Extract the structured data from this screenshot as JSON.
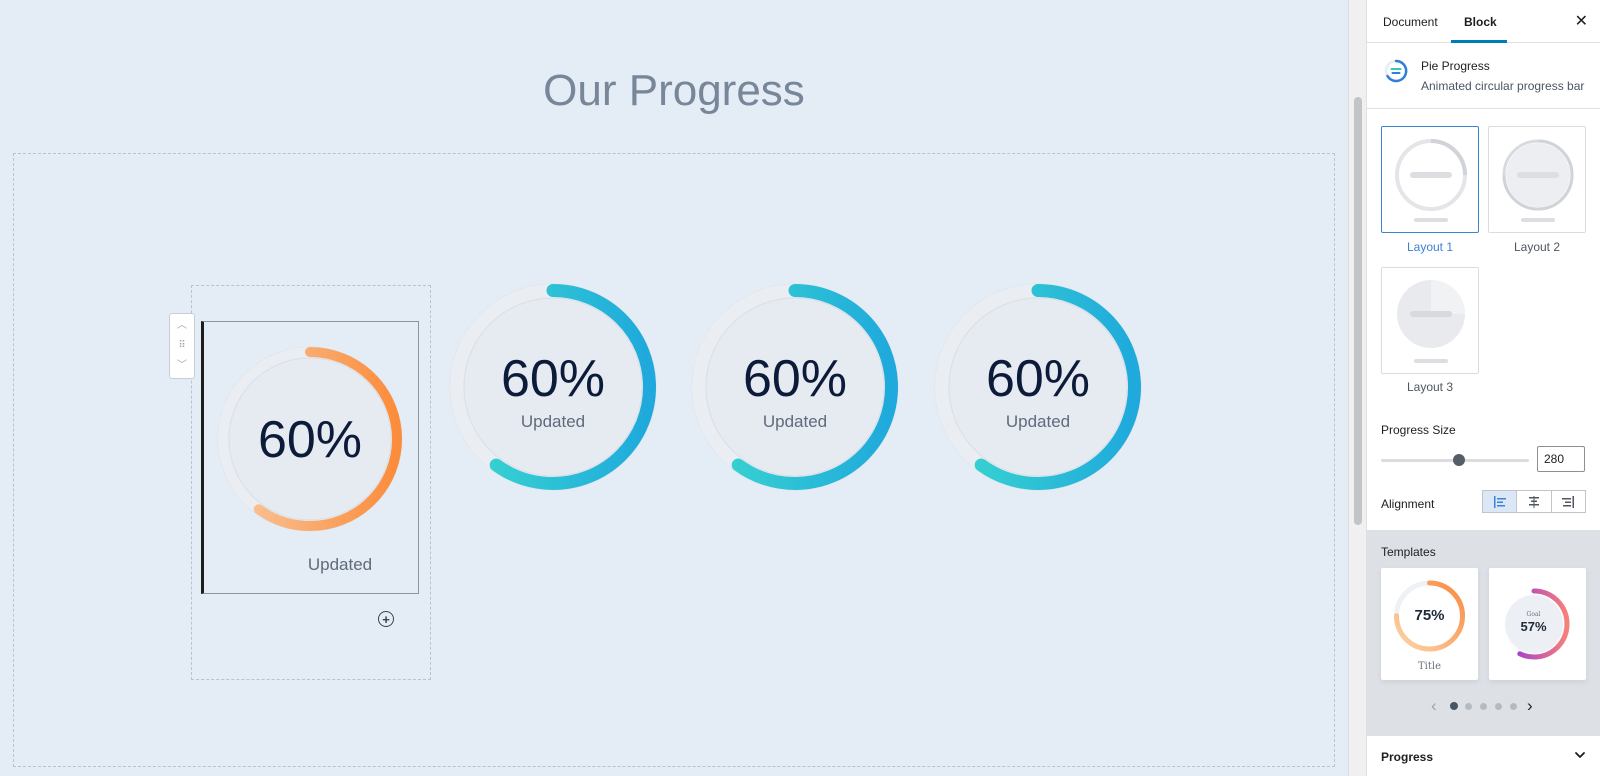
{
  "canvas": {
    "heading": "Our Progress",
    "pies": [
      {
        "percent": "60%",
        "label": "Updated",
        "progress": 0.6,
        "style": "orange"
      },
      {
        "percent": "60%",
        "label": "Updated",
        "progress": 0.6,
        "style": "teal"
      },
      {
        "percent": "60%",
        "label": "Updated",
        "progress": 0.6,
        "style": "teal"
      },
      {
        "percent": "60%",
        "label": "Updated",
        "progress": 0.6,
        "style": "teal"
      }
    ],
    "colors": {
      "orange_start": "#f9c9a1",
      "orange_end": "#fb8c3b",
      "teal_start": "#3ad8cf",
      "teal_end": "#1fa9dc",
      "track": "#eaedf2"
    }
  },
  "sidebar": {
    "tabs": {
      "document": "Document",
      "block": "Block"
    },
    "close_icon": "close-icon",
    "block": {
      "name": "Pie Progress",
      "description": "Animated circular progress bar"
    },
    "layouts": [
      {
        "label": "Layout 1",
        "selected": true
      },
      {
        "label": "Layout 2",
        "selected": false
      },
      {
        "label": "Layout 3",
        "selected": false
      }
    ],
    "progress_size": {
      "label": "Progress Size",
      "value": "280",
      "slider_fraction": 0.53
    },
    "alignment": {
      "label": "Alignment",
      "options": [
        "left",
        "center",
        "right"
      ],
      "selected": "left"
    },
    "templates": {
      "title": "Templates",
      "items": [
        {
          "percent": "75%",
          "caption": "Title",
          "progress": 0.75
        },
        {
          "percent": "57%",
          "caption": "Goal",
          "progress": 0.57
        }
      ],
      "page_count": 5,
      "current_page": 1
    },
    "progress_panel": {
      "title": "Progress"
    },
    "accent": "#007cba"
  }
}
